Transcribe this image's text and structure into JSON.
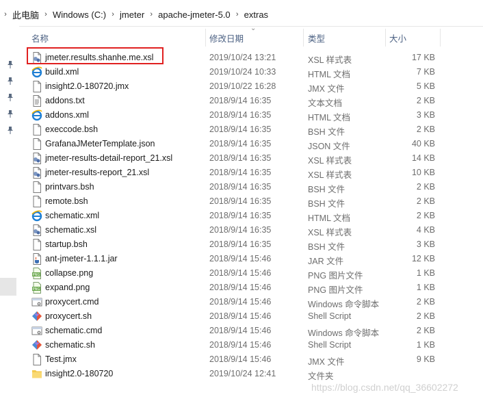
{
  "breadcrumb": [
    "此电脑",
    "Windows (C:)",
    "jmeter",
    "apache-jmeter-5.0",
    "extras"
  ],
  "columns": {
    "name": "名称",
    "date": "修改日期",
    "type": "类型",
    "size": "大小"
  },
  "files": [
    {
      "name": "jmeter.results.shanhe.me.xsl",
      "date": "2019/10/24 13:21",
      "type": "XSL 样式表",
      "size": "17 KB",
      "icon": "xsl"
    },
    {
      "name": "build.xml",
      "date": "2019/10/24 10:33",
      "type": "HTML 文档",
      "size": "7 KB",
      "icon": "ie"
    },
    {
      "name": "insight2.0-180720.jmx",
      "date": "2019/10/22 16:28",
      "type": "JMX 文件",
      "size": "5 KB",
      "icon": "blank"
    },
    {
      "name": "addons.txt",
      "date": "2018/9/14 16:35",
      "type": "文本文档",
      "size": "2 KB",
      "icon": "txt"
    },
    {
      "name": "addons.xml",
      "date": "2018/9/14 16:35",
      "type": "HTML 文档",
      "size": "3 KB",
      "icon": "ie"
    },
    {
      "name": "execcode.bsh",
      "date": "2018/9/14 16:35",
      "type": "BSH 文件",
      "size": "2 KB",
      "icon": "blank"
    },
    {
      "name": "GrafanaJMeterTemplate.json",
      "date": "2018/9/14 16:35",
      "type": "JSON 文件",
      "size": "40 KB",
      "icon": "blank"
    },
    {
      "name": "jmeter-results-detail-report_21.xsl",
      "date": "2018/9/14 16:35",
      "type": "XSL 样式表",
      "size": "14 KB",
      "icon": "xsl"
    },
    {
      "name": "jmeter-results-report_21.xsl",
      "date": "2018/9/14 16:35",
      "type": "XSL 样式表",
      "size": "10 KB",
      "icon": "xsl"
    },
    {
      "name": "printvars.bsh",
      "date": "2018/9/14 16:35",
      "type": "BSH 文件",
      "size": "2 KB",
      "icon": "blank"
    },
    {
      "name": "remote.bsh",
      "date": "2018/9/14 16:35",
      "type": "BSH 文件",
      "size": "2 KB",
      "icon": "blank"
    },
    {
      "name": "schematic.xml",
      "date": "2018/9/14 16:35",
      "type": "HTML 文档",
      "size": "2 KB",
      "icon": "ie"
    },
    {
      "name": "schematic.xsl",
      "date": "2018/9/14 16:35",
      "type": "XSL 样式表",
      "size": "4 KB",
      "icon": "xsl"
    },
    {
      "name": "startup.bsh",
      "date": "2018/9/14 16:35",
      "type": "BSH 文件",
      "size": "3 KB",
      "icon": "blank"
    },
    {
      "name": "ant-jmeter-1.1.1.jar",
      "date": "2018/9/14 15:46",
      "type": "JAR 文件",
      "size": "12 KB",
      "icon": "jar"
    },
    {
      "name": "collapse.png",
      "date": "2018/9/14 15:46",
      "type": "PNG 图片文件",
      "size": "1 KB",
      "icon": "png"
    },
    {
      "name": "expand.png",
      "date": "2018/9/14 15:46",
      "type": "PNG 图片文件",
      "size": "1 KB",
      "icon": "png"
    },
    {
      "name": "proxycert.cmd",
      "date": "2018/9/14 15:46",
      "type": "Windows 命令脚本",
      "size": "2 KB",
      "icon": "cmd"
    },
    {
      "name": "proxycert.sh",
      "date": "2018/9/14 15:46",
      "type": "Shell Script",
      "size": "2 KB",
      "icon": "sh"
    },
    {
      "name": "schematic.cmd",
      "date": "2018/9/14 15:46",
      "type": "Windows 命令脚本",
      "size": "2 KB",
      "icon": "cmd"
    },
    {
      "name": "schematic.sh",
      "date": "2018/9/14 15:46",
      "type": "Shell Script",
      "size": "1 KB",
      "icon": "sh"
    },
    {
      "name": "Test.jmx",
      "date": "2018/9/14 15:46",
      "type": "JMX 文件",
      "size": "9 KB",
      "icon": "blank"
    },
    {
      "name": "insight2.0-180720",
      "date": "2019/10/24 12:41",
      "type": "文件夹",
      "size": "",
      "icon": "folder"
    }
  ],
  "watermark": "https://blog.csdn.net/qq_36602272"
}
